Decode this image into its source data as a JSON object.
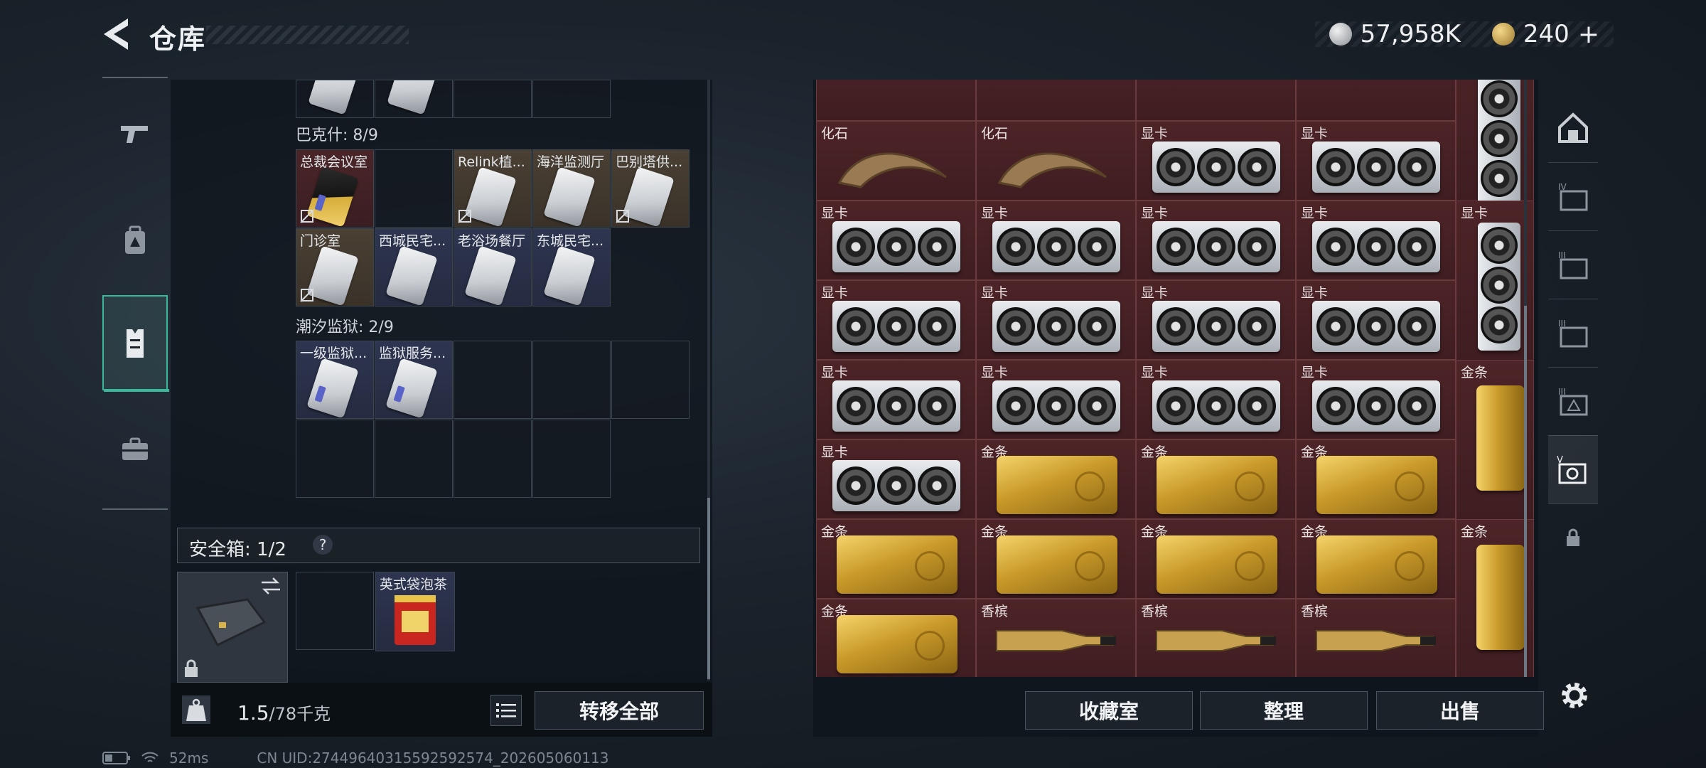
{
  "header": {
    "title": "仓库",
    "currency": [
      {
        "icon": "silver-coin-icon",
        "value": "57,958K"
      },
      {
        "icon": "gold-coin-icon",
        "value": "240"
      }
    ],
    "add_symbol": "+"
  },
  "left_nav": [
    {
      "icon": "gun-icon",
      "active": false
    },
    {
      "icon": "backpack-icon",
      "active": false
    },
    {
      "icon": "vest-icon",
      "active": true
    },
    {
      "icon": "briefcase-icon",
      "active": false
    }
  ],
  "left_panel": {
    "groups": [
      {
        "label": "巴克什: 8/9",
        "items": [
          "总裁会议室",
          "",
          "Relink植...",
          "海洋监测厅",
          "巴别塔供...",
          "门诊室",
          "西城民宅...",
          "老浴场餐厅",
          "东城民宅..."
        ]
      },
      {
        "label": "潮汐监狱: 2/9",
        "items": [
          "一级监狱...",
          "监狱服务..."
        ]
      }
    ],
    "safebox": {
      "label": "安全箱: 1/2",
      "help": "?",
      "item": "英式袋泡茶"
    },
    "weight": {
      "current": "1.5",
      "max": "/78千克"
    },
    "transfer_all": "转移全部"
  },
  "right_panel": {
    "labels": {
      "fossil": "化石",
      "gpu": "显卡",
      "gold": "金条",
      "champagne": "香槟"
    },
    "buttons": {
      "collection": "收藏室",
      "organize": "整理",
      "sell": "出售"
    },
    "sidetabs": [
      "home-icon",
      "IV",
      "III",
      "III",
      "III",
      "V",
      "lock-icon"
    ]
  },
  "footer": {
    "ping": "52ms",
    "uid": "CN UID:2744964031559259​2574_202605060113"
  },
  "colors": {
    "accent": "#39b89a",
    "item_bg": "#4a2226",
    "gold": "#c99a2a"
  }
}
